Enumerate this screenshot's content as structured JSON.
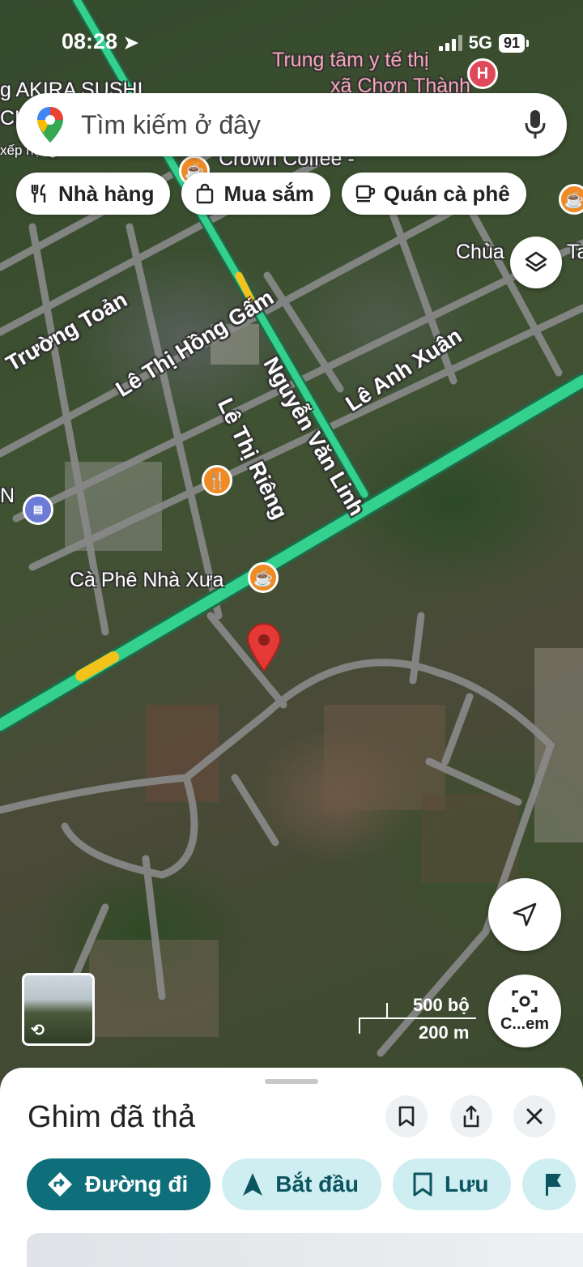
{
  "status_bar": {
    "time": "08:28",
    "network": "5G",
    "battery": "91"
  },
  "search": {
    "placeholder": "Tìm kiếm ở đây"
  },
  "chips": [
    {
      "label": "Nhà hàng",
      "icon": "fork-knife-icon"
    },
    {
      "label": "Mua sắm",
      "icon": "shopping-bag-icon"
    },
    {
      "label": "Quán cà phê",
      "icon": "coffee-cup-icon"
    }
  ],
  "map": {
    "roads": {
      "nguyen_van_linh": "Nguyễn Văn Linh",
      "le_thi_hong_gam": "Lê Thị Hồng Gấm",
      "le_thi_rieng": "Lê Thị Riêng",
      "le_anh_xuan": "Lê Anh Xuân",
      "truong_toan": "Trường Toản"
    },
    "pois": {
      "hospital": "Trung tâm y tế thị",
      "hospital_line2": "xã Chơn Thành",
      "akira": "g AKIRA SUSHI",
      "akira_line2": "CH",
      "akira_line3": "xếp hạng",
      "crown": "Crown Coffee -",
      "chua": "Chùa",
      "chua_tail": "Ta",
      "caphe": "Cà Phê Nhà Xưa",
      "left_n": "N"
    },
    "scale": {
      "imperial": "500 bộ",
      "metric": "200 m"
    },
    "lens_label": "C...em",
    "colors": {
      "highway": "#2fd08c",
      "pin": "#e53935",
      "road": "#8a8a8a"
    }
  },
  "sheet": {
    "title": "Ghim đã thả",
    "actions": {
      "directions": "Đường đi",
      "start": "Bắt đầu",
      "save": "Lưu"
    }
  }
}
